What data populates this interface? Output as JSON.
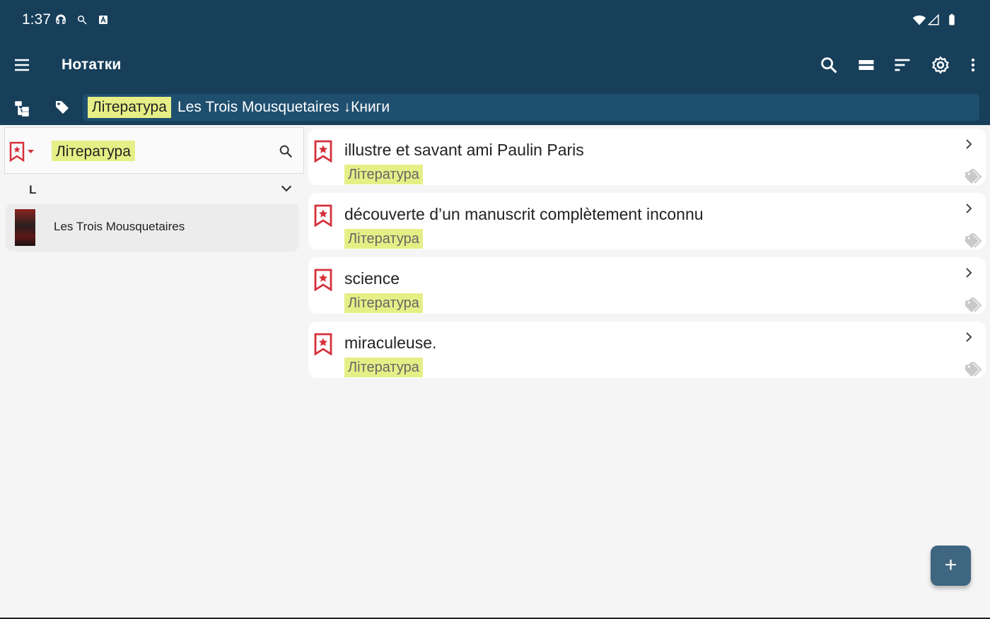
{
  "status_bar": {
    "time": "1:37",
    "icons": [
      "headset-icon",
      "sparkle-search-icon",
      "app-a-icon",
      "wifi-icon",
      "cell-signal-icon",
      "battery-icon"
    ]
  },
  "app_bar": {
    "title": "Нотатки",
    "actions": [
      "search-icon",
      "view-list-icon",
      "sort-icon",
      "settings-icon",
      "more-vert-icon"
    ]
  },
  "filter_bar": {
    "highlighted_tag": "Література",
    "context": "Les Trois Mousquetaires ↓Книги"
  },
  "left_panel": {
    "search_value": "Література",
    "section_letter": "L",
    "book": {
      "title": "Les Trois Mousquetaires"
    }
  },
  "notes": [
    {
      "title": "illustre et savant ami Paulin Paris",
      "tag": "Література"
    },
    {
      "title": "découverte d’un manuscrit complètement inconnu",
      "tag": "Література"
    },
    {
      "title": "science",
      "tag": "Література"
    },
    {
      "title": "miraculeuse.",
      "tag": "Література"
    }
  ],
  "fab": {
    "label": "+"
  },
  "colors": {
    "primary_dark": "#173f5a",
    "filter_pill": "#1f4f6f",
    "highlight": "#e6ef86",
    "bookmark_red": "#d5313b",
    "fab": "#3f6680"
  }
}
